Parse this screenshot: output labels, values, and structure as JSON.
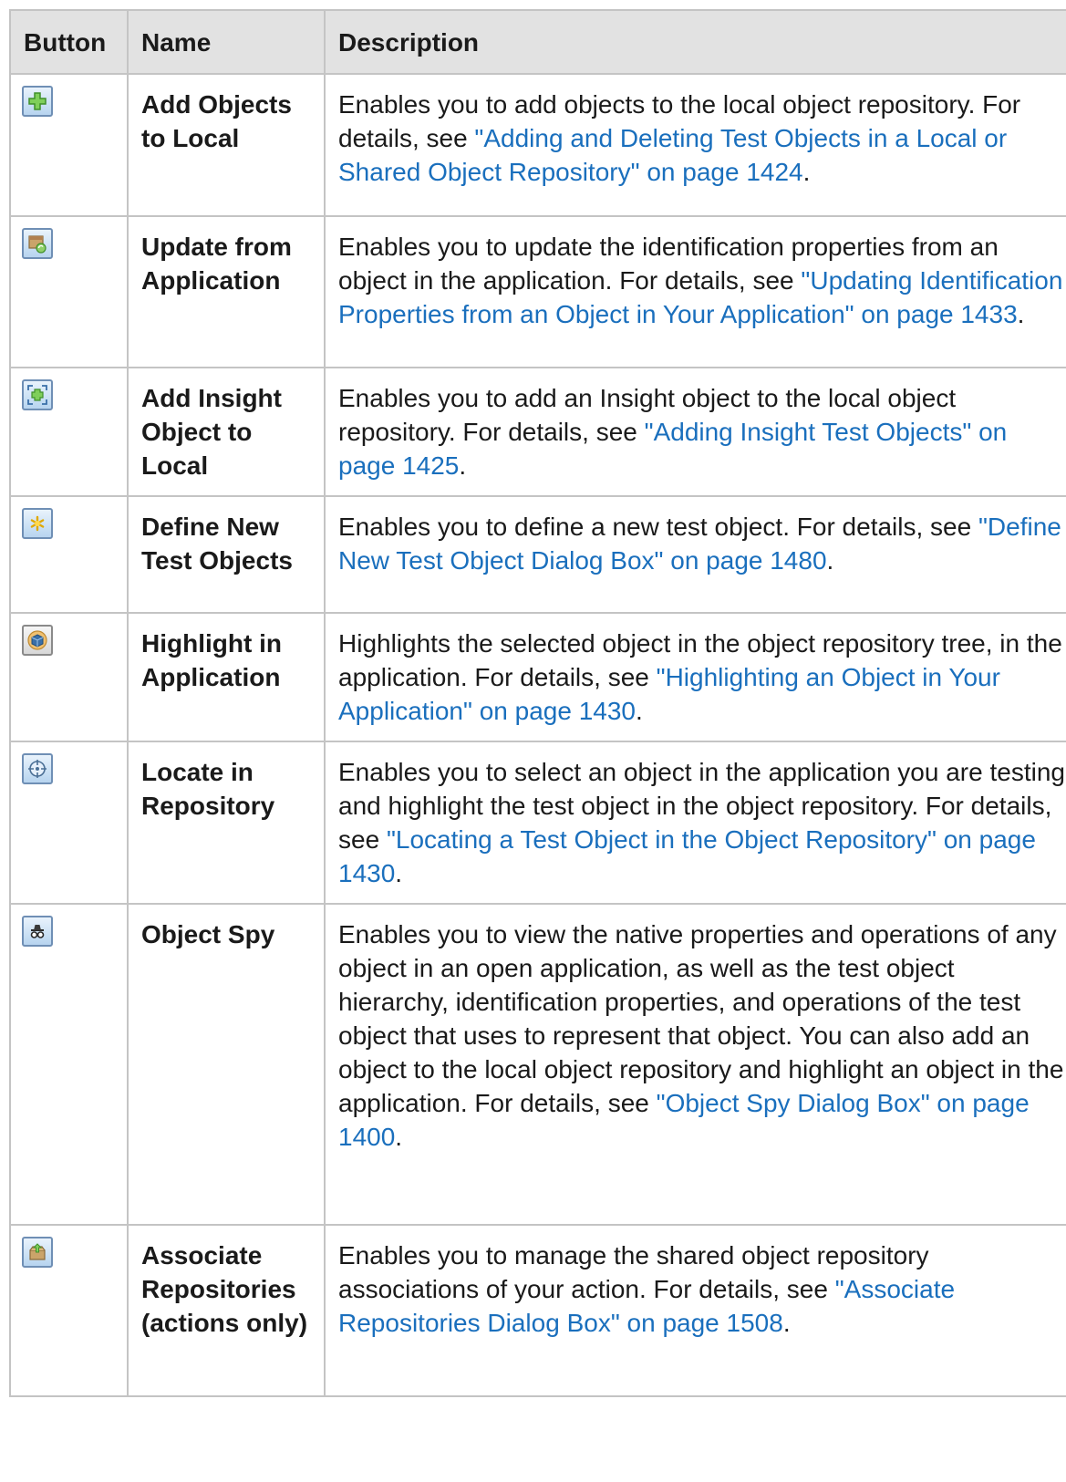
{
  "header": {
    "button": "Button",
    "name": "Name",
    "description": "Description"
  },
  "rows": [
    {
      "icon": "add-objects-icon",
      "name": "Add Objects to Local",
      "text": "Enables you to add objects to the local object repository. For details, see ",
      "link": "\"Adding and Deleting Test Objects in a Local or Shared Object Repository\" on page 1424",
      "end": "."
    },
    {
      "icon": "update-from-application-icon",
      "name": "Update from Application",
      "text": "Enables you to update the identification properties from an object in the application. For details, see ",
      "link": "\"Updating Identification Properties from an Object in Your Application\" on page 1433",
      "end": "."
    },
    {
      "icon": "add-insight-object-icon",
      "name": "Add Insight Object to Local",
      "text": "Enables you to add an Insight object to the local object repository. For details, see ",
      "link": "\"Adding Insight Test Objects\" on page 1425",
      "end": "."
    },
    {
      "icon": "define-new-test-object-icon",
      "name": "Define New Test Objects",
      "text": "Enables you to define a new test object. For details, see ",
      "link": "\"Define New Test Object Dialog Box\" on page 1480",
      "end": "."
    },
    {
      "icon": "highlight-in-application-icon",
      "name": "Highlight in Application",
      "text": "Highlights the selected object in the object repository tree, in the application. For details, see ",
      "link": "\"Highlighting an Object in Your Application\" on page 1430",
      "end": "."
    },
    {
      "icon": "locate-in-repository-icon",
      "name": "Locate in Repository",
      "text": "Enables you to select an object in the application you are testing and highlight the test object in the object repository. For details, see ",
      "link": "\"Locating a Test Object in the Object Repository\" on page 1430",
      "end": "."
    },
    {
      "icon": "object-spy-icon",
      "name": "Object Spy",
      "text": "Enables you to view the native properties and operations of any object in an open application, as well as the test object hierarchy, identification properties, and operations of the test object that uses to represent that object. You can also add an object to the local object repository and highlight an object in the application. For details, see ",
      "link": "\"Object Spy Dialog Box\" on page 1400",
      "end": "."
    },
    {
      "icon": "associate-repositories-icon",
      "name": "Associate Repositories (actions only)",
      "text": "Enables you to manage the shared object repository associations of your action. For details, see ",
      "link": "\"Associate Repositories Dialog Box\" on page 1508",
      "end": "."
    }
  ]
}
